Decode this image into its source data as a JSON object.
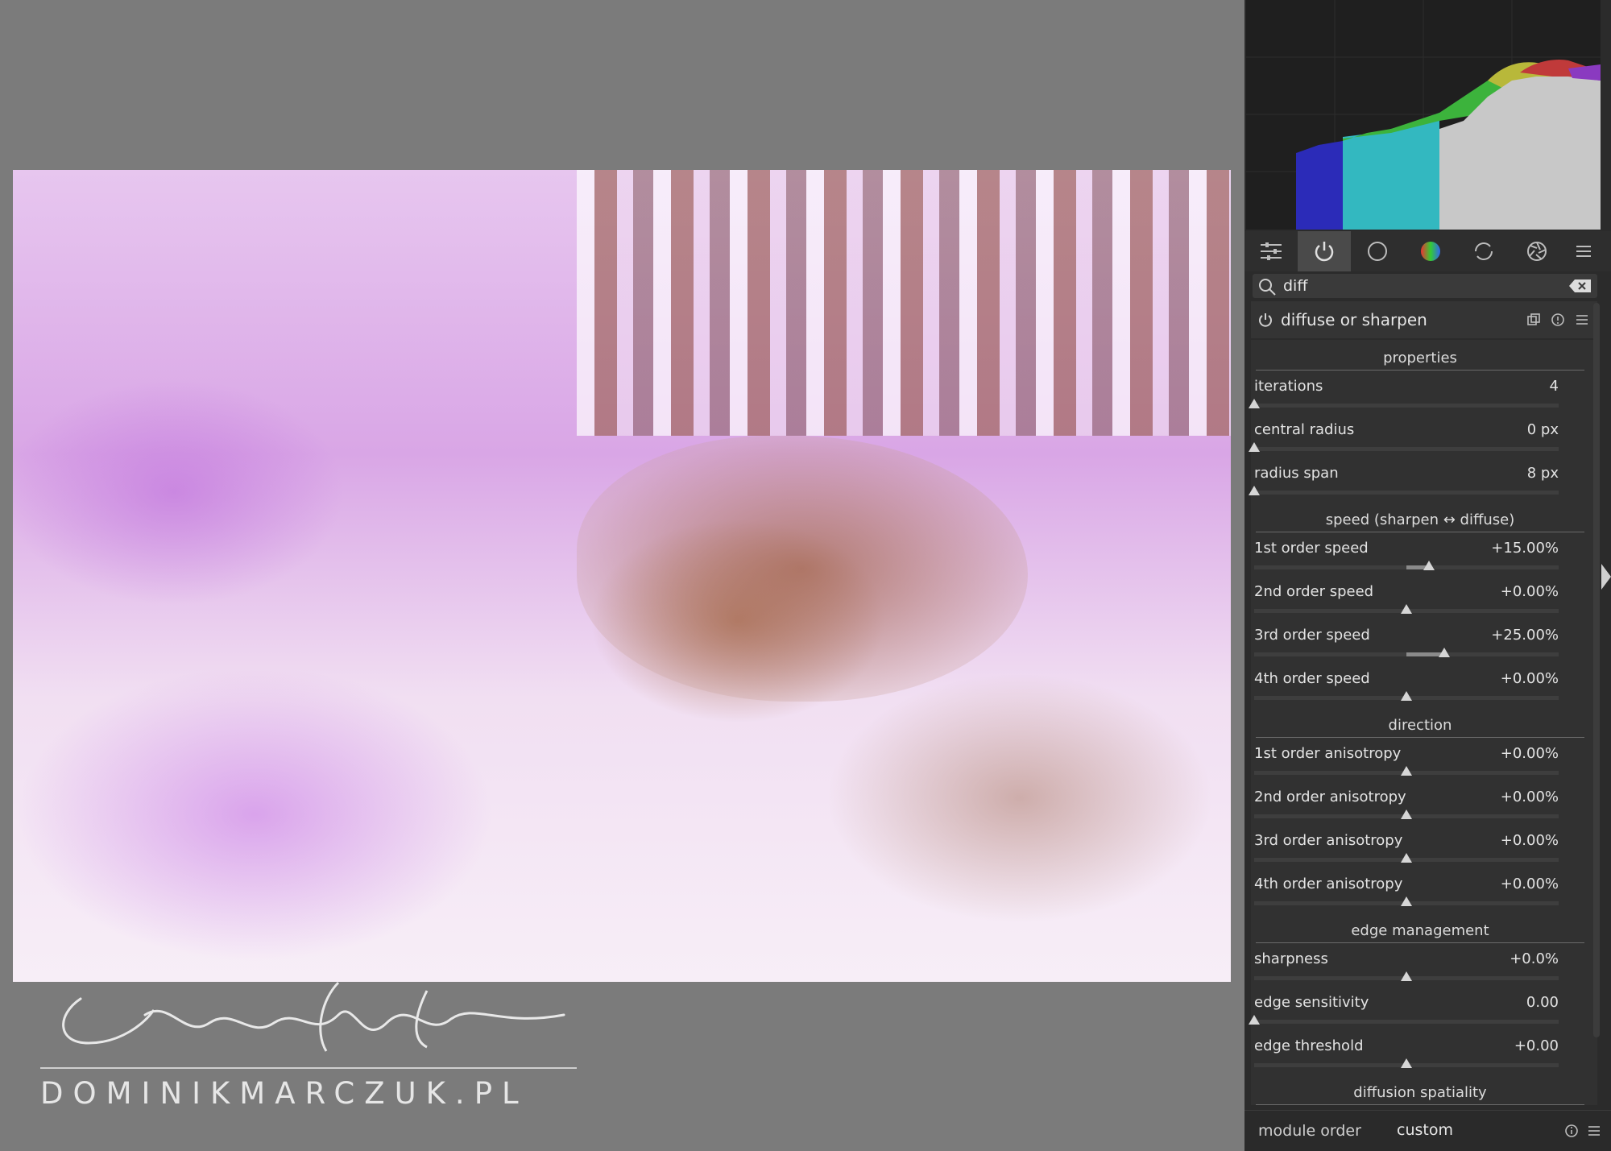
{
  "watermark": {
    "text": "DOMINIKMARCZUK.PL"
  },
  "search": {
    "value": "diff"
  },
  "module": {
    "title": "diffuse or sharpen",
    "sections": [
      {
        "title": "properties",
        "rows": [
          {
            "label": "iterations",
            "value": "4",
            "pos": 0.0
          },
          {
            "label": "central radius",
            "value": "0 px",
            "pos": 0.0
          },
          {
            "label": "radius span",
            "value": "8 px",
            "pos": 0.0
          }
        ]
      },
      {
        "title": "speed (sharpen ↔ diffuse)",
        "rows": [
          {
            "label": "1st order speed",
            "value": "+15.00%",
            "pos": 0.575
          },
          {
            "label": "2nd order speed",
            "value": "+0.00%",
            "pos": 0.5
          },
          {
            "label": "3rd order speed",
            "value": "+25.00%",
            "pos": 0.625
          },
          {
            "label": "4th order speed",
            "value": "+0.00%",
            "pos": 0.5
          }
        ]
      },
      {
        "title": "direction",
        "rows": [
          {
            "label": "1st order anisotropy",
            "value": "+0.00%",
            "pos": 0.5
          },
          {
            "label": "2nd order anisotropy",
            "value": "+0.00%",
            "pos": 0.5
          },
          {
            "label": "3rd order anisotropy",
            "value": "+0.00%",
            "pos": 0.5
          },
          {
            "label": "4th order anisotropy",
            "value": "+0.00%",
            "pos": 0.5
          }
        ]
      },
      {
        "title": "edge management",
        "rows": [
          {
            "label": "sharpness",
            "value": "+0.0%",
            "pos": 0.5
          },
          {
            "label": "edge sensitivity",
            "value": "0.00",
            "pos": 0.0
          },
          {
            "label": "edge threshold",
            "value": "+0.00",
            "pos": 0.5
          }
        ]
      },
      {
        "title": "diffusion spatiality",
        "rows": []
      }
    ]
  },
  "bottombar": {
    "label": "module order",
    "value": "custom"
  },
  "colors": {
    "panel": "#2b2b2b",
    "accent": "#d6d6d6"
  }
}
